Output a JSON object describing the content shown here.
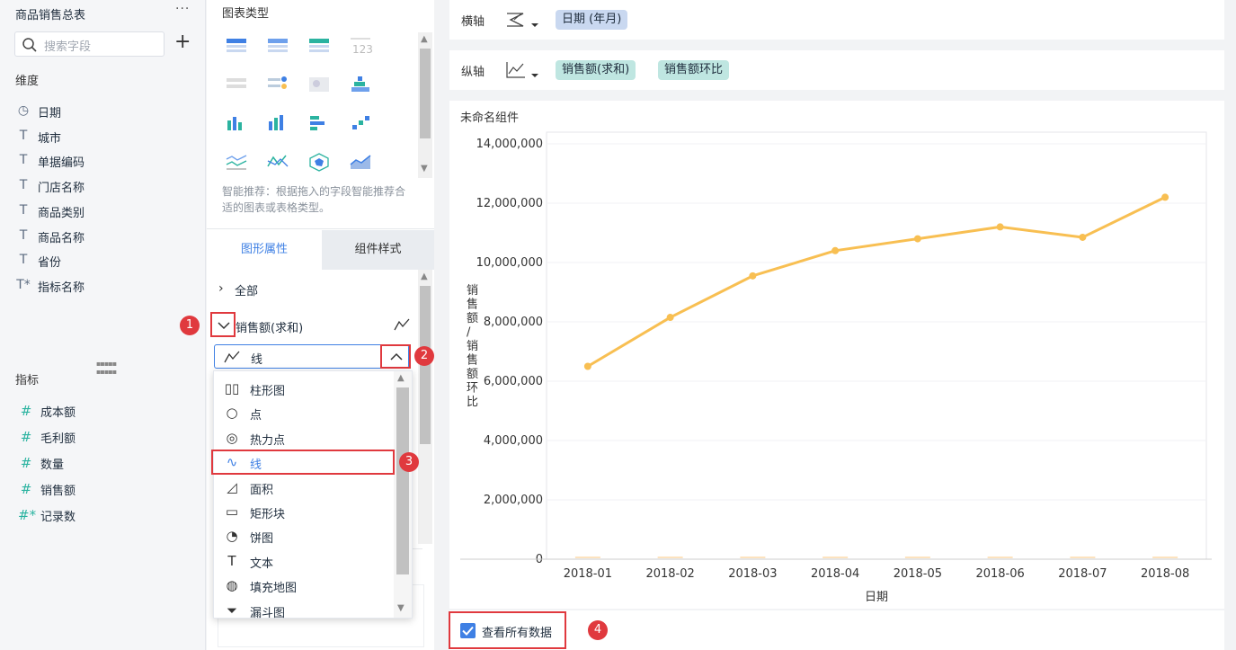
{
  "left_panel": {
    "title": "商品销售总表",
    "more": "···",
    "search_placeholder": "搜索字段",
    "add": "+",
    "dimensions_title": "维度",
    "dimensions": [
      {
        "icon": "clock-icon",
        "glyph": "◷",
        "label": "日期"
      },
      {
        "icon": "text-type-icon",
        "glyph": "T",
        "label": "城市"
      },
      {
        "icon": "text-type-icon",
        "glyph": "T",
        "label": "单据编码"
      },
      {
        "icon": "text-type-icon",
        "glyph": "T",
        "label": "门店名称"
      },
      {
        "icon": "text-type-icon",
        "glyph": "T",
        "label": "商品类别"
      },
      {
        "icon": "text-type-icon",
        "glyph": "T",
        "label": "商品名称"
      },
      {
        "icon": "text-type-icon",
        "glyph": "T",
        "label": "省份"
      },
      {
        "icon": "text-type-calc-icon",
        "glyph": "T*",
        "label": "指标名称"
      }
    ],
    "measures_title": "指标",
    "measures": [
      {
        "icon": "number-icon",
        "glyph": "#",
        "label": "成本额"
      },
      {
        "icon": "number-icon",
        "glyph": "#",
        "label": "毛利额"
      },
      {
        "icon": "number-icon",
        "glyph": "#",
        "label": "数量"
      },
      {
        "icon": "number-icon",
        "glyph": "#",
        "label": "销售额"
      },
      {
        "icon": "number-calc-icon",
        "glyph": "#*",
        "label": "记录数"
      }
    ]
  },
  "chart_type_panel": {
    "title": "图表类型",
    "hint": "智能推荐：根据拖入的字段智能推荐合适的图表或表格类型。",
    "tabs": [
      "图形属性",
      "组件样式"
    ],
    "all_label": "全部",
    "measure_label": "销售额(求和)",
    "selected_type": "线",
    "options": [
      {
        "icon": "bar-chart-icon",
        "glyph": "▯▯",
        "label": "柱形图"
      },
      {
        "icon": "circle-icon",
        "glyph": "○",
        "label": "点"
      },
      {
        "icon": "heat-point-icon",
        "glyph": "◎",
        "label": "热力点"
      },
      {
        "icon": "line-icon",
        "glyph": "∿",
        "label": "线"
      },
      {
        "icon": "area-icon",
        "glyph": "◿",
        "label": "面积"
      },
      {
        "icon": "rectangle-icon",
        "glyph": "▭",
        "label": "矩形块"
      },
      {
        "icon": "pie-icon",
        "glyph": "◔",
        "label": "饼图"
      },
      {
        "icon": "text-icon",
        "glyph": "T",
        "label": "文本"
      },
      {
        "icon": "fill-map-icon",
        "glyph": "◍",
        "label": "填充地图"
      },
      {
        "icon": "funnel-icon",
        "glyph": "⏷",
        "label": "漏斗图"
      }
    ]
  },
  "axes": {
    "x_label": "横轴",
    "x_field": "日期 (年月)",
    "y_label": "纵轴",
    "y_fields": [
      "销售额(求和)",
      "销售额环比"
    ]
  },
  "widget_title": "未命名组件",
  "view_all_label": "查看所有数据",
  "badges": [
    "1",
    "2",
    "3",
    "4"
  ],
  "colors": {
    "accent": "#3f80e4",
    "line": "#f8bf52",
    "pill_blue": "#c9d8f0",
    "pill_green": "#bfe6e1",
    "annotation_red": "#e0393e"
  },
  "chart_data": {
    "type": "line",
    "categories": [
      "2018-01",
      "2018-02",
      "2018-03",
      "2018-04",
      "2018-05",
      "2018-06",
      "2018-07",
      "2018-08"
    ],
    "series": [
      {
        "values": [
          6500000,
          8150000,
          9550000,
          10400000,
          10800000,
          11200000,
          10850000,
          12200000
        ]
      }
    ],
    "xlabel": "日期",
    "ylabel": "销售额/销售额环比",
    "ylim": [
      0,
      14000000
    ],
    "yticks": [
      "14,000,000",
      "12,000,000",
      "10,000,000",
      "8,000,000",
      "6,000,000",
      "4,000,000",
      "2,000,000",
      "0"
    ],
    "grid": true
  }
}
